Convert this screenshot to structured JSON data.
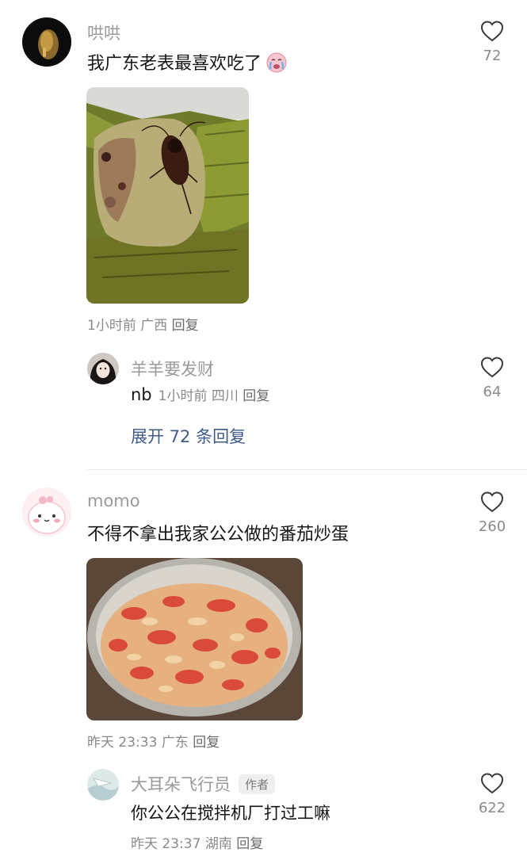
{
  "comments": [
    {
      "username": "哄哄",
      "text": "我广东老表最喜欢吃了",
      "emoji": "crying-face-emoji",
      "meta": {
        "time": "1小时前",
        "location": "广西",
        "reply": "回复"
      },
      "likes": "72",
      "replies": [
        {
          "username": "羊羊要发财",
          "text": "nb",
          "meta": {
            "time": "1小时前",
            "location": "四川",
            "reply": "回复"
          },
          "likes": "64"
        }
      ],
      "expand_label": "展开 72 条回复"
    },
    {
      "username": "momo",
      "text": "不得不拿出我家公公做的番茄炒蛋",
      "meta": {
        "time": "昨天 23:33",
        "location": "广东",
        "reply": "回复"
      },
      "likes": "260",
      "replies": [
        {
          "username": "大耳朵飞行员",
          "badge": "作者",
          "text": "你公公在搅拌机厂打过工嘛",
          "meta": {
            "time": "昨天 23:37",
            "location": "湖南",
            "reply": "回复"
          },
          "likes": "622"
        }
      ]
    }
  ],
  "colors": {
    "link": "#3f5b86",
    "muted": "#8a8a8a",
    "text": "#161616"
  }
}
